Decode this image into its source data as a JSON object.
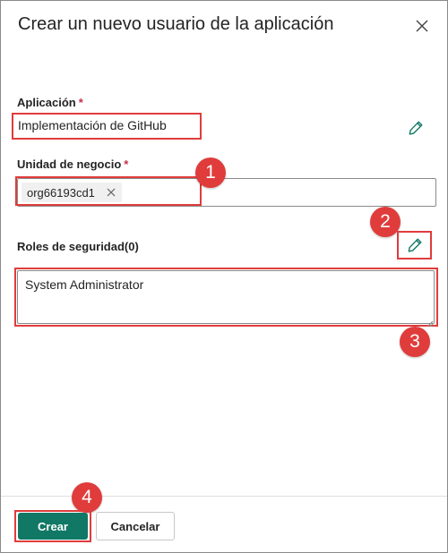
{
  "dialog": {
    "title": "Crear un nuevo usuario de la aplicación"
  },
  "application": {
    "label": "Aplicación",
    "required_mark": "*",
    "value": "Implementación de GitHub"
  },
  "business_unit": {
    "label": "Unidad de negocio",
    "required_mark": "*",
    "tag": "org66193cd1"
  },
  "security_roles": {
    "label": "Roles de seguridad(0)",
    "value": "System Administrator"
  },
  "steps": {
    "one": "1",
    "two": "2",
    "three": "3",
    "four": "4"
  },
  "footer": {
    "create_label": "Crear",
    "cancel_label": "Cancelar"
  },
  "colors": {
    "primary": "#117865",
    "highlight": "#e03c3c",
    "required": "#c4314b"
  },
  "icons": {
    "close": "close-icon",
    "edit": "pencil-icon",
    "remove_tag": "close-icon"
  }
}
